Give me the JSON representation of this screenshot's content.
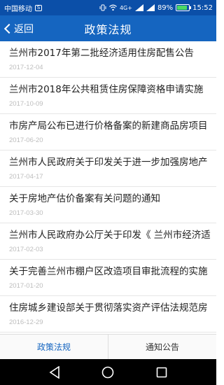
{
  "status_bar": {
    "carrier": "中国移动",
    "network": "4G+",
    "battery": "89%",
    "battery_level": 0.89,
    "time": "15:52"
  },
  "nav": {
    "back_label": "返回",
    "title": "政策法规"
  },
  "list": [
    {
      "title": "兰州市2017年第二批经济适用住房配售公告",
      "date": "2017-12-04"
    },
    {
      "title": "兰州市2018年公共租赁住房保障资格申请实施",
      "date": "2017-10-09"
    },
    {
      "title": "市房产局公布已进行价格备案的新建商品房项目",
      "date": "2017-06-20"
    },
    {
      "title": "兰州市人民政府关于印发关于进一步加强房地产",
      "date": "2017-04-17"
    },
    {
      "title": "关于房地产估价备案有关问题的通知",
      "date": "2017-03-30"
    },
    {
      "title": "兰州市人民政府办公厅关于印发《 兰州市经济适",
      "date": "2017-02-03"
    },
    {
      "title": "关于完善兰州市棚户区改造项目审批流程的实施",
      "date": "2017-01-20"
    },
    {
      "title": "住房城乡建设部关于贯彻落实资产评估法规范房",
      "date": "2016-12-29"
    }
  ],
  "tabs": [
    {
      "label": "政策法规",
      "active": true
    },
    {
      "label": "通知公告",
      "active": false
    }
  ],
  "colors": {
    "nav_bar": "#1565c0",
    "status_bar": "#0b4fa8",
    "active_tab": "#1565c0"
  }
}
